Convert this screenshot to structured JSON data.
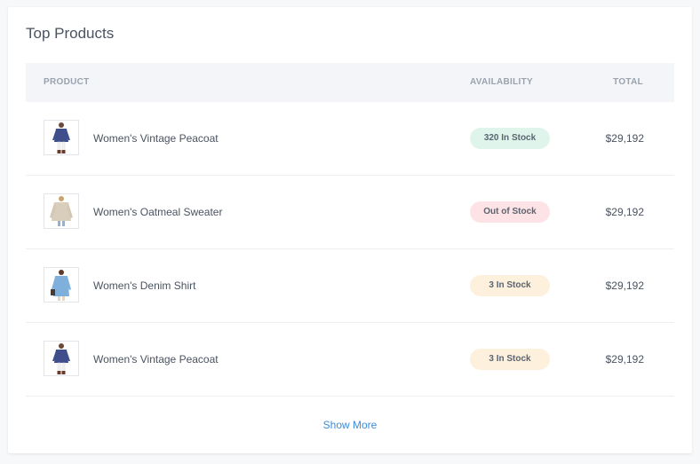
{
  "card": {
    "title": "Top Products"
  },
  "table": {
    "headers": {
      "product": "PRODUCT",
      "availability": "AVAILABILITY",
      "total": "TOTAL"
    },
    "rows": [
      {
        "name": "Women's Vintage Peacoat",
        "availability": "320 In Stock",
        "status": "in-stock",
        "total": "$29,192",
        "image": "peacoat-product-image"
      },
      {
        "name": "Women's Oatmeal Sweater",
        "availability": "Out of Stock",
        "status": "out-of-stock",
        "total": "$29,192",
        "image": "sweater-product-image"
      },
      {
        "name": "Women's Denim Shirt",
        "availability": "3 In Stock",
        "status": "low-stock",
        "total": "$29,192",
        "image": "denim-shirt-product-image"
      },
      {
        "name": "Women's Vintage Peacoat",
        "availability": "3 In Stock",
        "status": "low-stock",
        "total": "$29,192",
        "image": "peacoat-product-image"
      }
    ]
  },
  "footer": {
    "show_more": "Show More"
  },
  "colors": {
    "in_stock_bg": "#dff5ec",
    "out_of_stock_bg": "#fde3e5",
    "low_stock_bg": "#fdf0dc",
    "link": "#3d8bd8"
  }
}
